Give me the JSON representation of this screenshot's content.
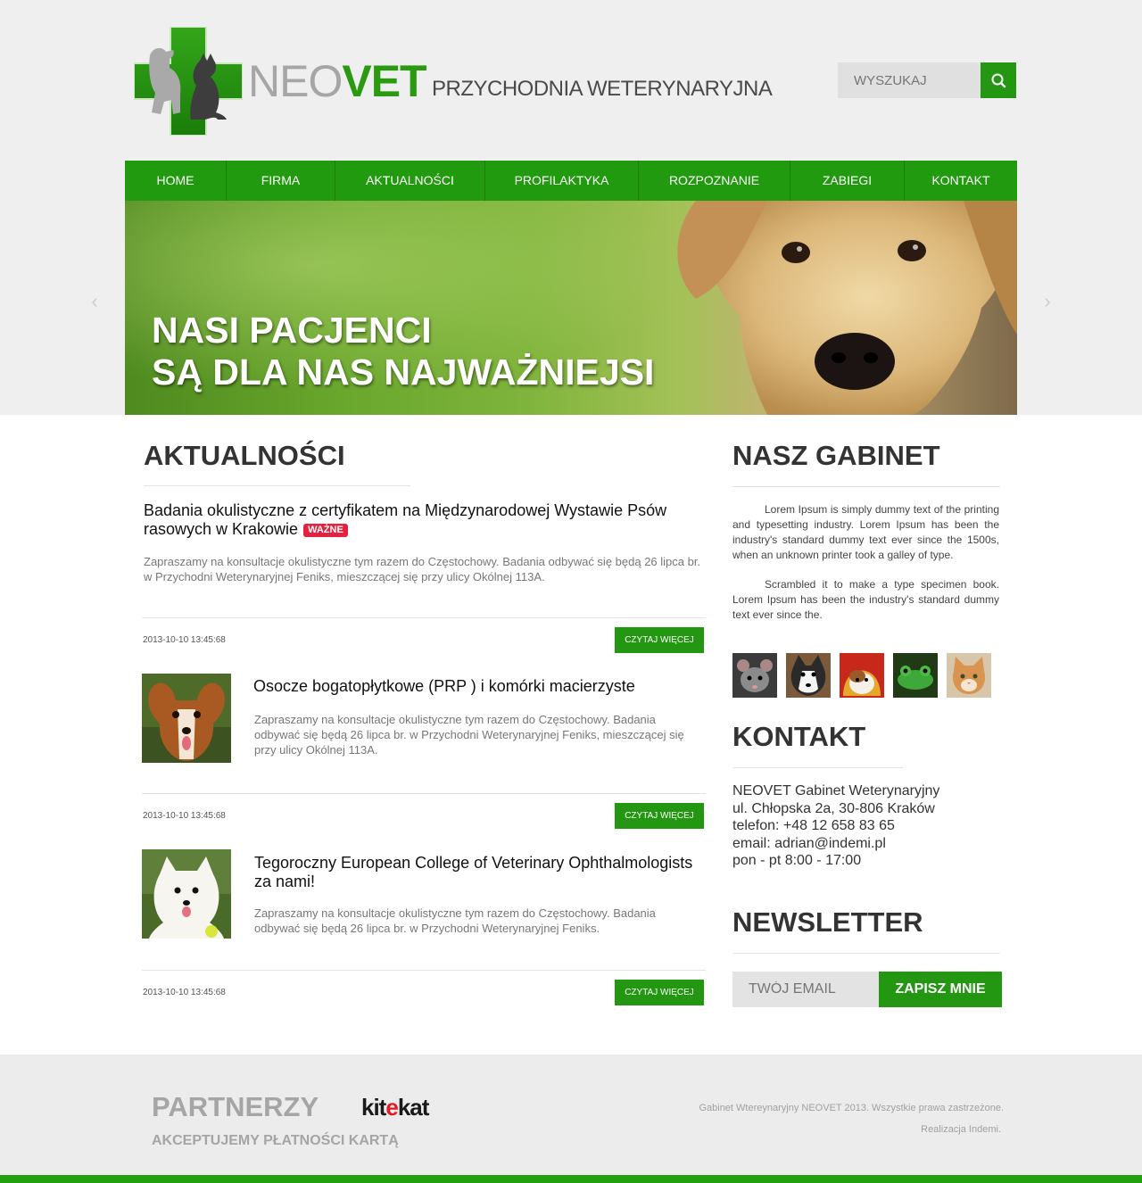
{
  "header": {
    "brand_neo": "NEO",
    "brand_vet": "VET",
    "tagline": "PRZYCHODNIA WETERYNARYJNA",
    "search_placeholder": "WYSZUKAJ"
  },
  "nav": {
    "items": [
      {
        "label": "HOME"
      },
      {
        "label": "FIRMA"
      },
      {
        "label": "AKTUALNOŚCI"
      },
      {
        "label": "PROFILAKTYKA"
      },
      {
        "label": "ROZPOZNANIE"
      },
      {
        "label": "ZABIEGI"
      },
      {
        "label": "KONTAKT"
      }
    ]
  },
  "hero": {
    "line1": "NASI PACJENCI",
    "line2": "SĄ DLA NAS NAJWAŻNIEJSI"
  },
  "news": {
    "title": "AKTUALNOŚCI",
    "more_label": "CZYTAJ WIĘCEJ",
    "items": [
      {
        "title": "Badania okulistyczne z certyfikatem na Międzynarodowej Wystawie Psów rasowych w Krakowie",
        "badge": "WAŻNE",
        "text": "Zapraszamy na konsultacje okulistyczne tym razem do Częstochowy. Badania odbywać się będą 26  lipca br. w Przychodni Weterynaryjnej Feniks, mieszczącej się przy ulicy Okólnej 113A.",
        "date": "2013-10-10 13:45:68"
      },
      {
        "title": "Osocze bogatopłytkowe (PRP ) i komórki macierzyste",
        "text": "Zapraszamy na konsultacje okulistyczne tym razem do Częstochowy. Badania odbywać się będą 26  lipca br. w Przychodni Weterynaryjnej Feniks, mieszczącej się przy ulicy Okólnej 113A.",
        "date": "2013-10-10 13:45:68"
      },
      {
        "title": "Tegoroczny European College of Veterinary Ophthalmologists za nami!",
        "text": "Zapraszamy na konsultacje okulistyczne tym razem do Częstochowy. Badania odbywać się będą 26  lipca br. w Przychodni Weterynaryjnej Feniks.",
        "date": "2013-10-10 13:45:68"
      }
    ]
  },
  "clinic": {
    "title": "NASZ GABINET",
    "para1": "Lorem Ipsum is simply dummy text of the printing and typesetting industry. Lorem Ipsum has been the industry's standard dummy text ever since the 1500s, when an unknown printer took a galley of type.",
    "para2": "Scrambled it to make a type specimen book. Lorem Ipsum has been the industry's standard dummy text ever since the."
  },
  "contact": {
    "title": "KONTAKT",
    "lines": [
      "NEOVET Gabinet Weterynaryjny",
      "ul. Chłopska 2a, 30-806 Kraków",
      "telefon: +48 12 658 83 65",
      "email: adrian@indemi.pl",
      "pon - pt 8:00 - 17:00"
    ]
  },
  "newsletter": {
    "title": "NEWSLETTER",
    "placeholder": "TWÓJ EMAIL",
    "button": "ZAPISZ MNIE"
  },
  "footer": {
    "partners": "PARTNERZY",
    "partner_logo_a": "kit",
    "partner_logo_e": "e",
    "partner_logo_b": "kat",
    "payments": "AKCEPTUJEMY PŁATNOŚCI KARTĄ",
    "copyright": "Gabinet Wtereynaryjny NEOVET 2013. Wszystkie prawa zastrzeżone.",
    "credits": "Realizacja Indemi."
  },
  "colors": {
    "accent": "#239612",
    "badge": "#e3223f"
  }
}
